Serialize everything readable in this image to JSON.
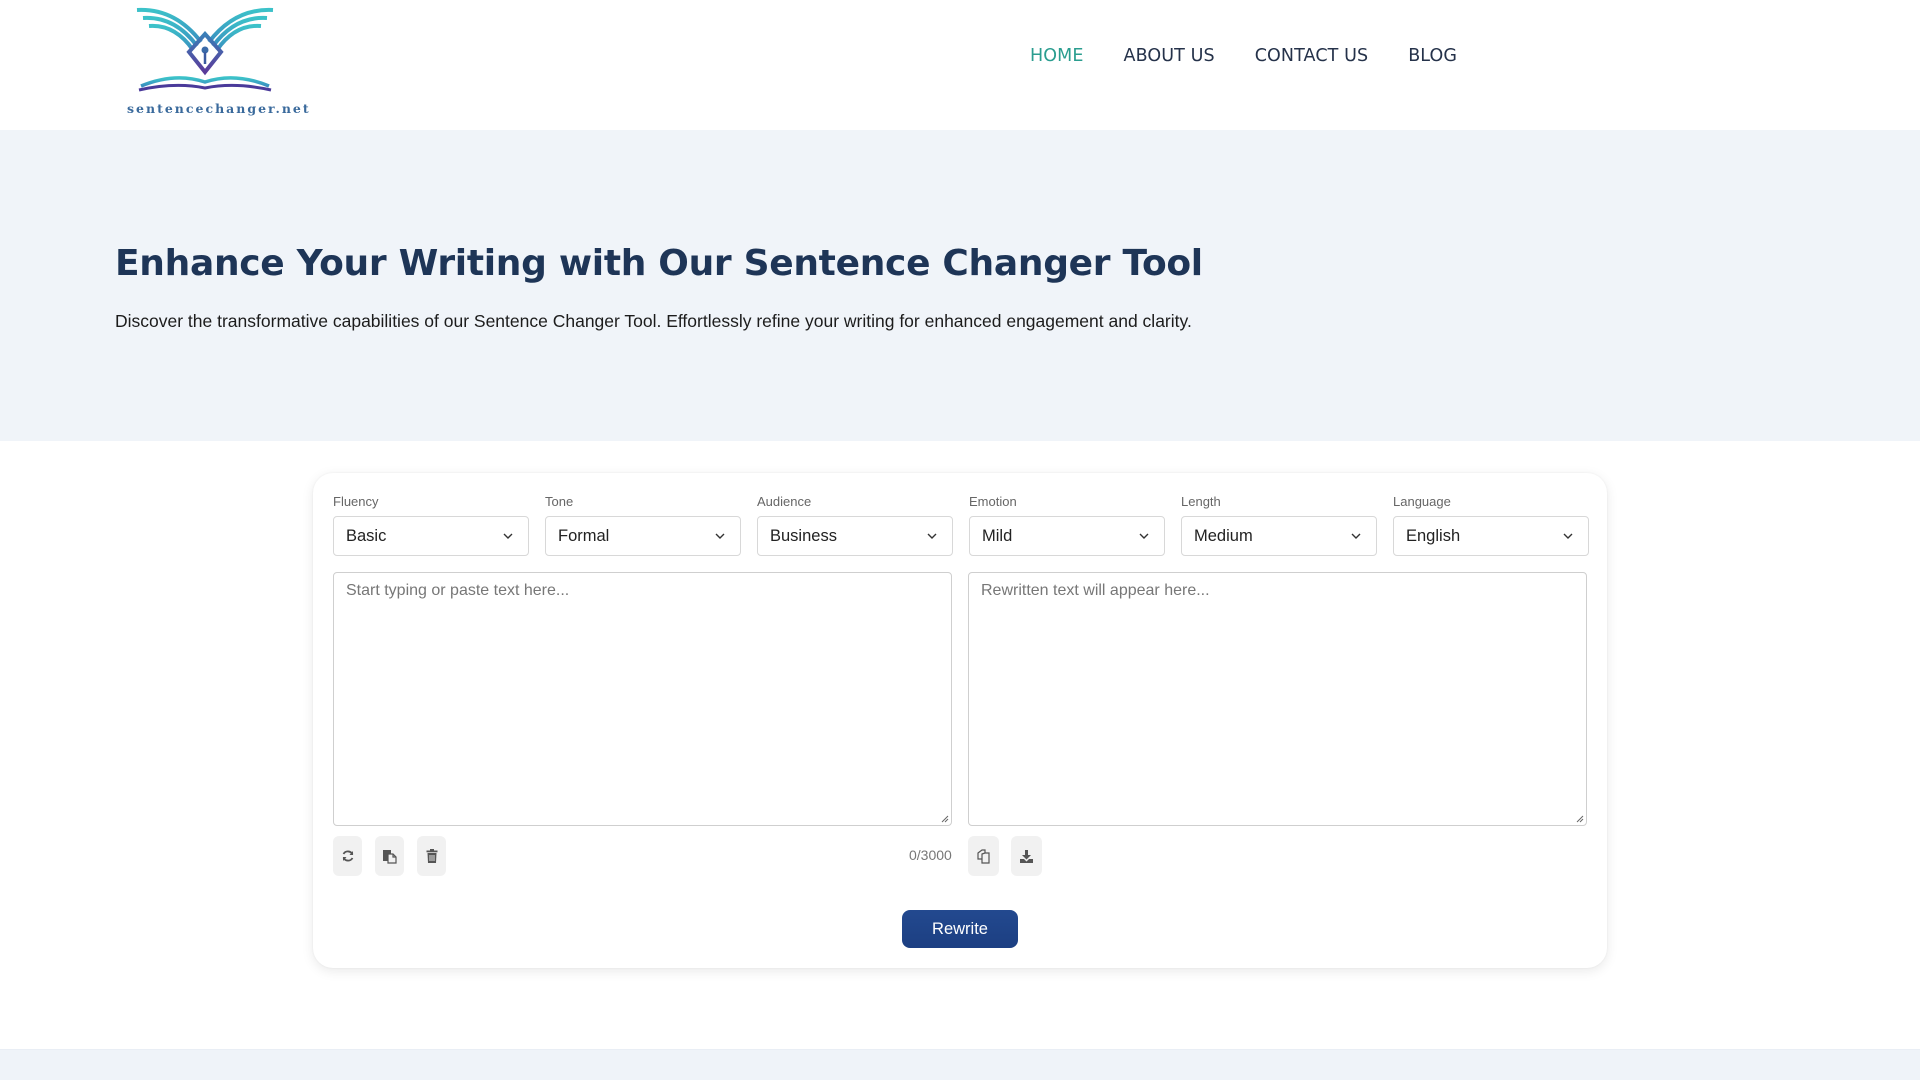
{
  "header": {
    "logo_text": "sentencechanger.net",
    "nav": [
      {
        "label": "HOME",
        "active": true
      },
      {
        "label": "ABOUT US",
        "active": false
      },
      {
        "label": "CONTACT US",
        "active": false
      },
      {
        "label": "BLOG",
        "active": false
      }
    ]
  },
  "hero": {
    "title": "Enhance Your Writing with Our Sentence Changer Tool",
    "subtitle": "Discover the transformative capabilities of our Sentence Changer Tool. Effortlessly refine your writing for enhanced engagement and clarity."
  },
  "tool": {
    "selects": [
      {
        "label": "Fluency",
        "value": "Basic"
      },
      {
        "label": "Tone",
        "value": "Formal"
      },
      {
        "label": "Audience",
        "value": "Business"
      },
      {
        "label": "Emotion",
        "value": "Mild"
      },
      {
        "label": "Length",
        "value": "Medium"
      },
      {
        "label": "Language",
        "value": "English"
      }
    ],
    "input": {
      "placeholder": "Start typing or paste text here...",
      "value": ""
    },
    "output": {
      "placeholder": "Rewritten text will appear here...",
      "value": ""
    },
    "left_actions": [
      "refresh-icon",
      "paste-icon",
      "trash-icon"
    ],
    "right_actions": [
      "copy-icon",
      "download-icon"
    ],
    "char_count": "0/3000",
    "rewrite_label": "Rewrite"
  },
  "colors": {
    "nav_active": "#2a9d8f",
    "nav_text": "#25324a",
    "heading": "#1e3557",
    "hero_bg": "#f0f4f9",
    "button": "#1f4489"
  }
}
